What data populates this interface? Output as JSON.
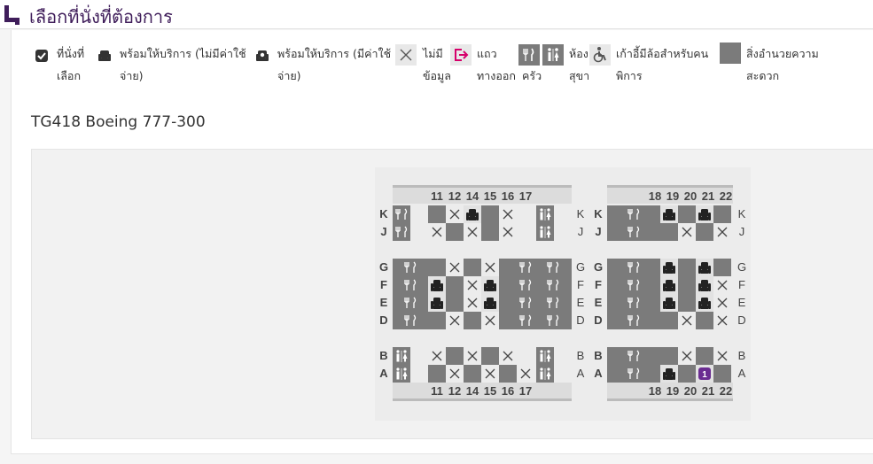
{
  "header": {
    "title": "เลือกที่นั่งที่ต้องการ"
  },
  "legend": {
    "selected": [
      "ที่นั่งที่",
      "เลือก"
    ],
    "free": [
      "พร้อมให้บริการ (ไม่มีค่าใช้",
      "จ่าย)"
    ],
    "paid": [
      "พร้อมให้บริการ (มีค่าใช้",
      "จ่าย)"
    ],
    "no_info": [
      "ไม่มี",
      "ข้อมูล"
    ],
    "exit": [
      "แถว",
      "ทางออก"
    ],
    "galley": "ครัว",
    "lavatory": [
      "ห้อง",
      "สุขา"
    ],
    "wheelchair": [
      "เก้าอี้มีล้อสำหรับคน",
      "พิการ"
    ],
    "facility": [
      "สิ่งอำนวยความ",
      "สะดวก"
    ]
  },
  "flight": {
    "label": "TG418 Boeing 777-300"
  },
  "colors": {
    "accent": "#6a2c91",
    "header_title": "#3f1d5a",
    "block": "#7b7b7b",
    "exit": "#d6006b"
  },
  "seat_map": {
    "left": {
      "rows": [
        "11",
        "12",
        "14",
        "15",
        "16",
        "17"
      ],
      "groups": [
        {
          "letters": [
            "K",
            "J"
          ],
          "cells": [
            [
              "galley",
              "grid",
              "x",
              "free",
              "grid",
              "x",
              "lav"
            ],
            [
              "galley",
              "x",
              "grid",
              "x",
              "grid",
              "x",
              "lav"
            ]
          ]
        },
        {
          "letters": [
            "G",
            "F",
            "E",
            "D"
          ],
          "cells": [
            [
              "galley",
              "grid",
              "x",
              "grid",
              "x",
              "grid",
              "x",
              "galley"
            ],
            [
              "galley",
              "free",
              "grid",
              "x",
              "free",
              "grid",
              "galley"
            ],
            [
              "galley",
              "free",
              "grid",
              "x",
              "free",
              "grid",
              "galley"
            ],
            [
              "galley",
              "grid",
              "x",
              "grid",
              "x",
              "grid",
              "x",
              "galley"
            ]
          ]
        },
        {
          "letters": [
            "B",
            "A"
          ],
          "cells": [
            [
              "lav",
              "x",
              "grid",
              "x",
              "grid",
              "x",
              "lav"
            ],
            [
              "lav",
              "grid",
              "x",
              "grid",
              "x",
              "grid",
              "x",
              "lav"
            ]
          ]
        }
      ]
    },
    "right": {
      "rows": [
        "18",
        "19",
        "20",
        "21",
        "22"
      ],
      "groups": [
        {
          "letters": [
            "K",
            "J"
          ],
          "cells": [
            [
              "galley",
              "free",
              "grid",
              "free",
              "grid"
            ],
            [
              "galley",
              "grid",
              "x",
              "grid",
              "x"
            ]
          ]
        },
        {
          "letters": [
            "G",
            "F",
            "E",
            "D"
          ],
          "cells": [
            [
              "galley",
              "free",
              "grid",
              "free",
              "grid"
            ],
            [
              "galley",
              "free",
              "grid",
              "free",
              "x"
            ],
            [
              "galley",
              "free",
              "grid",
              "free",
              "x"
            ],
            [
              "galley",
              "grid",
              "x",
              "grid",
              "free",
              "x"
            ]
          ]
        },
        {
          "letters": [
            "B",
            "A"
          ],
          "cells": [
            [
              "galley",
              "grid",
              "x",
              "grid",
              "x"
            ],
            [
              "galley",
              "free",
              "grid",
              "selected",
              "grid"
            ]
          ]
        }
      ]
    },
    "selected_badge": "1"
  }
}
